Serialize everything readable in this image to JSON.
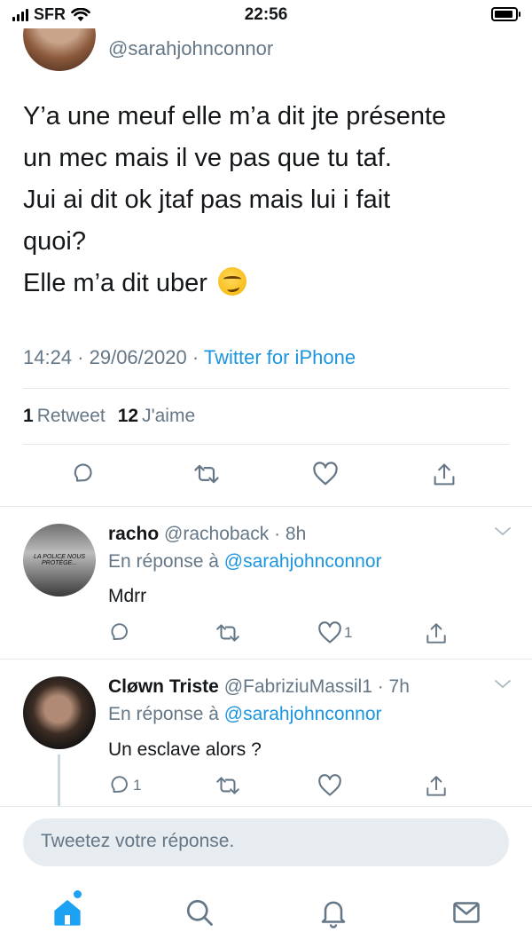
{
  "status_bar": {
    "carrier": "SFR",
    "time": "22:56"
  },
  "tweet": {
    "handle": "@sarahjohnconnor",
    "text": "Y’a une meuf elle m’a dit jte présente\nun mec mais il ve pas que tu taf.\nJui ai dit ok jtaf pas mais lui i fait\nquoi?\nElle m’a dit uber",
    "emoji": "smirking-face",
    "timestamp": "14:24 · 29/06/2020 · ",
    "source": "Twitter for iPhone",
    "retweet_count": "1",
    "retweet_label": "Retweet",
    "like_count": "12",
    "like_label": "J'aime"
  },
  "replies": [
    {
      "name": "racho",
      "handle_time": " @rachoback · 8h",
      "reply_prefix": "En réponse à ",
      "reply_mention": "@sarahjohnconnor",
      "text": "Mdrr",
      "avatar_text": "LA POLICE NOUS PROTÈGE...",
      "reply_count": "",
      "like_count": "1"
    },
    {
      "name": "Cløwn Triste",
      "handle_time": " @FabriziuMassil1 · 7h",
      "reply_prefix": "En réponse à ",
      "reply_mention": "@sarahjohnconnor",
      "text": "Un esclave alors ?",
      "reply_count": "1",
      "like_count": ""
    }
  ],
  "compose": {
    "placeholder": "Tweetez votre réponse."
  },
  "colors": {
    "accent": "#1da1f2",
    "link": "#1b95e0",
    "muted": "#657786"
  }
}
